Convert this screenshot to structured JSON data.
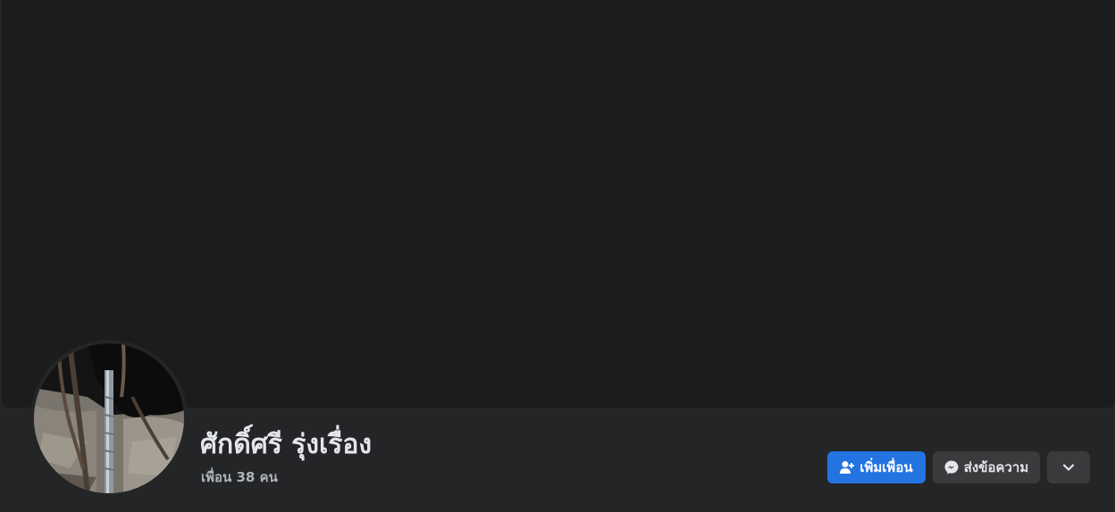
{
  "profile": {
    "name": "ศักดิ์ศรี รุ่งเรื่อง",
    "friends": "เพื่อน 38 คน"
  },
  "actions": {
    "add_friend_label": "เพิ่มเพื่อน",
    "message_label": "ส่งข้อความ",
    "more_icon": "chevron-down-icon"
  },
  "colors": {
    "page_bg": "#242526",
    "cover_bg": "#1b1c1e",
    "primary_button": "#2374e1",
    "secondary_button": "#3a3b3c",
    "text_primary": "#e4e6eb",
    "text_secondary": "#b0b3b8"
  }
}
